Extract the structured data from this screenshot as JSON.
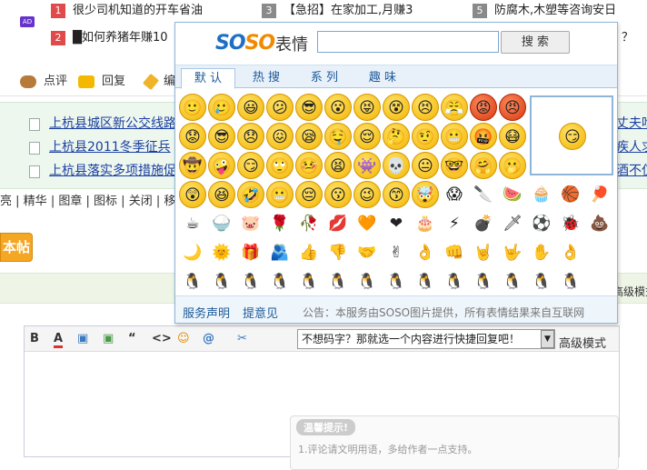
{
  "hot_list": [
    {
      "num": "1",
      "text": "很少司机知道的开车省油",
      "color": "red"
    },
    {
      "num": "3",
      "text": "【急招】在家加工,月赚3",
      "color": "gray"
    },
    {
      "num": "5",
      "text": "防腐木,木塑等咨询安日",
      "color": "gray"
    },
    {
      "num": "2",
      "text": "█如何养猪年赚10",
      "color": "red"
    },
    {
      "trailing": "？"
    }
  ],
  "ad_badge": "AD",
  "actions": [
    {
      "label": "点评"
    },
    {
      "label": "回复"
    },
    {
      "label": "编"
    }
  ],
  "news": [
    {
      "text": "上杭县城区新公交线路",
      "right": "丈夫吃"
    },
    {
      "text": "上杭县2011冬季征兵",
      "right": "疾人求"
    },
    {
      "text": "上杭县落实多项措施促",
      "right": "酒不仅"
    }
  ],
  "thread_tools": [
    "亮",
    "精华",
    "图章",
    "图标",
    "关闭",
    "移"
  ],
  "post_button": "本帖",
  "advanced_right": "高级模式",
  "editor": {
    "toolbar": [
      "B",
      "A",
      "▣",
      "▣",
      "“",
      "<>",
      "☺",
      "@",
      "✂"
    ],
    "quick_reply": "不想码字？那就选一个内容进行快捷回复吧！",
    "advanced_mode": "高级模式",
    "warm_tip_title": "温馨提示!",
    "warm_tip_line": "1.评论请文明用语，多给作者一点支持。"
  },
  "emoji_panel": {
    "logo": [
      "SO",
      "SO",
      "表情"
    ],
    "search_value": "",
    "search_button": "搜 索",
    "tabs": [
      "默 认",
      "热 搜",
      "系 列",
      "趣 味"
    ],
    "active_tab": 0,
    "emojis": [
      [
        "🙂",
        "🥲",
        "😃",
        "😕",
        "😎",
        "😮",
        "😝",
        "😵",
        "😣",
        "😤",
        "😡",
        "😠"
      ],
      [
        "😟",
        "😎",
        "😞",
        "😖",
        "😪",
        "🤤",
        "😌",
        "🤔",
        "🤨",
        "😬",
        "🤬",
        "😷"
      ],
      [
        "🤠",
        "🤪",
        "😏",
        "🙄",
        "🤒",
        "😫",
        "👾",
        "💀",
        "😐",
        "🤓",
        "🤗",
        "🫢"
      ],
      [
        "😲",
        "😆",
        "🤣",
        "😬",
        "😔",
        "😗",
        "😉",
        "😙",
        "🤯",
        "😱",
        "🔪",
        "🍉",
        "🧁",
        "🏀",
        "🏓"
      ],
      [
        "☕",
        "🍚",
        "🐷",
        "🌹",
        "🥀",
        "💋",
        "🧡",
        "❤",
        "🎂",
        "⚡",
        "💣",
        "🗡",
        "⚽",
        "🐞",
        "💩"
      ],
      [
        "🌙",
        "🌞",
        "🎁",
        "🫂",
        "👍",
        "👎",
        "🤝",
        "✌",
        "👌",
        "👊",
        "🤘",
        "🤟",
        "✋",
        "👌"
      ],
      [
        "🐧",
        "🐧",
        "🐧",
        "🐧",
        "🐧",
        "🐧",
        "🐧",
        "🐧",
        "🐧",
        "🐧",
        "🐧",
        "🐧",
        "🐧",
        "🐧"
      ]
    ],
    "preview_emoji": "😏",
    "footer": {
      "statement": "服务声明",
      "feedback": "提意见",
      "notice": "公告：本服务由SOSO图片提供，所有表情结果来自互联网"
    }
  }
}
